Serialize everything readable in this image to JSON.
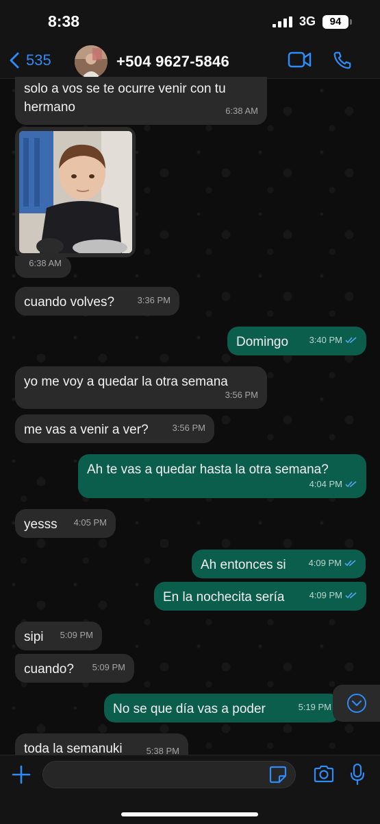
{
  "status": {
    "time": "8:38",
    "network": "3G",
    "battery": "94"
  },
  "header": {
    "back_count": "535",
    "contact": "+504 9627-5846"
  },
  "colors": {
    "accent": "#2f8bf7",
    "incoming": "#2a2a2b",
    "outgoing": "#0b5e4c",
    "read_tick": "#53a6f5"
  },
  "messages": [
    {
      "dir": "in",
      "text": "solo a vos se te ocurre venir con tu hermano",
      "time": "6:38 AM"
    },
    {
      "dir": "in",
      "type": "photo",
      "time": "6:38 AM"
    },
    {
      "dir": "in",
      "text": "cuando volves?",
      "time": "3:36 PM"
    },
    {
      "dir": "out",
      "text": "Domingo",
      "time": "3:40 PM",
      "read": true
    },
    {
      "dir": "in",
      "text": "yo me voy a quedar la otra semana",
      "time": "3:56 PM"
    },
    {
      "dir": "in",
      "text": "me vas a venir a ver?",
      "time": "3:56 PM"
    },
    {
      "dir": "out",
      "text": "Ah te vas a quedar hasta la otra semana?",
      "time": "4:04 PM",
      "read": true
    },
    {
      "dir": "in",
      "text": "yesss",
      "time": "4:05 PM"
    },
    {
      "dir": "out",
      "text": "Ah entonces si",
      "time": "4:09 PM",
      "read": true
    },
    {
      "dir": "out",
      "text": "En la nochecita sería",
      "time": "4:09 PM",
      "read": true
    },
    {
      "dir": "in",
      "text": "sipi",
      "time": "5:09 PM"
    },
    {
      "dir": "in",
      "text": "cuando?",
      "time": "5:09 PM"
    },
    {
      "dir": "out",
      "text": "No se que día vas a poder",
      "time": "5:19 PM"
    },
    {
      "dir": "in",
      "text": "toda la semanuki",
      "time": "5:38 PM"
    }
  ],
  "composer": {
    "placeholder": ""
  }
}
